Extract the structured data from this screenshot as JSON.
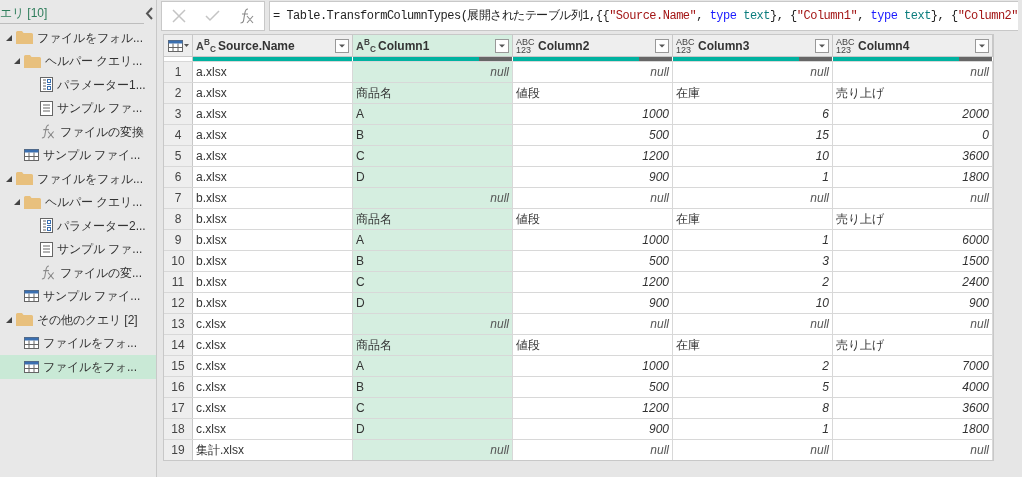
{
  "queries_pane": {
    "title": "エリ [10]",
    "tree": [
      {
        "label": "ファイルをフォル...",
        "kind": "folder",
        "expanded": true,
        "selected": false,
        "children": [
          {
            "label": "ヘルパー クエリ...",
            "kind": "folder",
            "expanded": true,
            "selected": false,
            "children": [
              {
                "label": "パラメーター1...",
                "kind": "parameter",
                "selected": false
              },
              {
                "label": "サンプル ファ...",
                "kind": "list",
                "selected": false
              },
              {
                "label": "ファイルの変換",
                "kind": "function",
                "selected": false
              }
            ]
          },
          {
            "label": "サンプル ファイ...",
            "kind": "table",
            "selected": false
          }
        ]
      },
      {
        "label": "ファイルをフォル...",
        "kind": "folder",
        "expanded": true,
        "selected": false,
        "children": [
          {
            "label": "ヘルパー クエリ...",
            "kind": "folder",
            "expanded": true,
            "selected": false,
            "children": [
              {
                "label": "パラメーター2...",
                "kind": "parameter",
                "selected": false
              },
              {
                "label": "サンプル ファ...",
                "kind": "list",
                "selected": false
              },
              {
                "label": "ファイルの変...",
                "kind": "function",
                "selected": false
              }
            ]
          },
          {
            "label": "サンプル ファイ...",
            "kind": "table",
            "selected": false
          }
        ]
      },
      {
        "label": "その他のクエリ [2]",
        "kind": "folder",
        "expanded": true,
        "selected": false,
        "children": [
          {
            "label": "ファイルをフォ...",
            "kind": "table",
            "selected": false
          },
          {
            "label": "ファイルをフォ...",
            "kind": "table",
            "selected": true
          }
        ]
      }
    ]
  },
  "formula_bar": {
    "tokens": [
      {
        "text": "= Table.TransformColumnTypes(展開されたテーブル列1,{{",
        "kind": "plain"
      },
      {
        "text": "\"Source.Name\"",
        "kind": "string"
      },
      {
        "text": ", ",
        "kind": "plain"
      },
      {
        "text": "type",
        "kind": "keyword"
      },
      {
        "text": " text",
        "kind": "type"
      },
      {
        "text": "}, {",
        "kind": "plain"
      },
      {
        "text": "\"Column1\"",
        "kind": "string"
      },
      {
        "text": ", ",
        "kind": "plain"
      },
      {
        "text": "type",
        "kind": "keyword"
      },
      {
        "text": " text",
        "kind": "type"
      },
      {
        "text": "}, {",
        "kind": "plain"
      },
      {
        "text": "\"Column2\"",
        "kind": "string"
      }
    ]
  },
  "table": {
    "columns": [
      {
        "name": "Source.Name",
        "type_label": [
          "A$^{B}$$_{C}$"
        ],
        "selected": false,
        "level": 1
      },
      {
        "name": "Column1",
        "type_label": [
          "A$^{B}$$_{C}$"
        ],
        "selected": true,
        "level": 0.79
      },
      {
        "name": "Column2",
        "type_label": [
          "ABC",
          "123"
        ],
        "selected": false,
        "level": 0.79
      },
      {
        "name": "Column3",
        "type_label": [
          "ABC",
          "123"
        ],
        "selected": false,
        "level": 0.79
      },
      {
        "name": "Column4",
        "type_label": [
          "ABC",
          "123"
        ],
        "selected": false,
        "level": 0.79
      }
    ],
    "rows": [
      {
        "index": "1",
        "cells": [
          {
            "text": "a.xlsx",
            "kind": "text"
          },
          {
            "text": "null",
            "kind": "null"
          },
          {
            "text": "null",
            "kind": "null"
          },
          {
            "text": "null",
            "kind": "null"
          },
          {
            "text": "null",
            "kind": "null"
          }
        ]
      },
      {
        "index": "2",
        "cells": [
          {
            "text": "a.xlsx",
            "kind": "text"
          },
          {
            "text": "商品名",
            "kind": "text"
          },
          {
            "text": "値段",
            "kind": "text"
          },
          {
            "text": "在庫",
            "kind": "text"
          },
          {
            "text": "売り上げ",
            "kind": "text"
          }
        ]
      },
      {
        "index": "3",
        "cells": [
          {
            "text": "a.xlsx",
            "kind": "text"
          },
          {
            "text": "A",
            "kind": "text"
          },
          {
            "text": "1000",
            "kind": "number"
          },
          {
            "text": "6",
            "kind": "number"
          },
          {
            "text": "2000",
            "kind": "number"
          }
        ]
      },
      {
        "index": "4",
        "cells": [
          {
            "text": "a.xlsx",
            "kind": "text"
          },
          {
            "text": "B",
            "kind": "text"
          },
          {
            "text": "500",
            "kind": "number"
          },
          {
            "text": "15",
            "kind": "number"
          },
          {
            "text": "0",
            "kind": "number"
          }
        ]
      },
      {
        "index": "5",
        "cells": [
          {
            "text": "a.xlsx",
            "kind": "text"
          },
          {
            "text": "C",
            "kind": "text"
          },
          {
            "text": "1200",
            "kind": "number"
          },
          {
            "text": "10",
            "kind": "number"
          },
          {
            "text": "3600",
            "kind": "number"
          }
        ]
      },
      {
        "index": "6",
        "cells": [
          {
            "text": "a.xlsx",
            "kind": "text"
          },
          {
            "text": "D",
            "kind": "text"
          },
          {
            "text": "900",
            "kind": "number"
          },
          {
            "text": "1",
            "kind": "number"
          },
          {
            "text": "1800",
            "kind": "number"
          }
        ]
      },
      {
        "index": "7",
        "cells": [
          {
            "text": "b.xlsx",
            "kind": "text"
          },
          {
            "text": "null",
            "kind": "null"
          },
          {
            "text": "null",
            "kind": "null"
          },
          {
            "text": "null",
            "kind": "null"
          },
          {
            "text": "null",
            "kind": "null"
          }
        ]
      },
      {
        "index": "8",
        "cells": [
          {
            "text": "b.xlsx",
            "kind": "text"
          },
          {
            "text": "商品名",
            "kind": "text"
          },
          {
            "text": "値段",
            "kind": "text"
          },
          {
            "text": "在庫",
            "kind": "text"
          },
          {
            "text": "売り上げ",
            "kind": "text"
          }
        ]
      },
      {
        "index": "9",
        "cells": [
          {
            "text": "b.xlsx",
            "kind": "text"
          },
          {
            "text": "A",
            "kind": "text"
          },
          {
            "text": "1000",
            "kind": "number"
          },
          {
            "text": "1",
            "kind": "number"
          },
          {
            "text": "6000",
            "kind": "number"
          }
        ]
      },
      {
        "index": "10",
        "cells": [
          {
            "text": "b.xlsx",
            "kind": "text"
          },
          {
            "text": "B",
            "kind": "text"
          },
          {
            "text": "500",
            "kind": "number"
          },
          {
            "text": "3",
            "kind": "number"
          },
          {
            "text": "1500",
            "kind": "number"
          }
        ]
      },
      {
        "index": "11",
        "cells": [
          {
            "text": "b.xlsx",
            "kind": "text"
          },
          {
            "text": "C",
            "kind": "text"
          },
          {
            "text": "1200",
            "kind": "number"
          },
          {
            "text": "2",
            "kind": "number"
          },
          {
            "text": "2400",
            "kind": "number"
          }
        ]
      },
      {
        "index": "12",
        "cells": [
          {
            "text": "b.xlsx",
            "kind": "text"
          },
          {
            "text": "D",
            "kind": "text"
          },
          {
            "text": "900",
            "kind": "number"
          },
          {
            "text": "10",
            "kind": "number"
          },
          {
            "text": "900",
            "kind": "number"
          }
        ]
      },
      {
        "index": "13",
        "cells": [
          {
            "text": "c.xlsx",
            "kind": "text"
          },
          {
            "text": "null",
            "kind": "null"
          },
          {
            "text": "null",
            "kind": "null"
          },
          {
            "text": "null",
            "kind": "null"
          },
          {
            "text": "null",
            "kind": "null"
          }
        ]
      },
      {
        "index": "14",
        "cells": [
          {
            "text": "c.xlsx",
            "kind": "text"
          },
          {
            "text": "商品名",
            "kind": "text"
          },
          {
            "text": "値段",
            "kind": "text"
          },
          {
            "text": "在庫",
            "kind": "text"
          },
          {
            "text": "売り上げ",
            "kind": "text"
          }
        ]
      },
      {
        "index": "15",
        "cells": [
          {
            "text": "c.xlsx",
            "kind": "text"
          },
          {
            "text": "A",
            "kind": "text"
          },
          {
            "text": "1000",
            "kind": "number"
          },
          {
            "text": "2",
            "kind": "number"
          },
          {
            "text": "7000",
            "kind": "number"
          }
        ]
      },
      {
        "index": "16",
        "cells": [
          {
            "text": "c.xlsx",
            "kind": "text"
          },
          {
            "text": "B",
            "kind": "text"
          },
          {
            "text": "500",
            "kind": "number"
          },
          {
            "text": "5",
            "kind": "number"
          },
          {
            "text": "4000",
            "kind": "number"
          }
        ]
      },
      {
        "index": "17",
        "cells": [
          {
            "text": "c.xlsx",
            "kind": "text"
          },
          {
            "text": "C",
            "kind": "text"
          },
          {
            "text": "1200",
            "kind": "number"
          },
          {
            "text": "8",
            "kind": "number"
          },
          {
            "text": "3600",
            "kind": "number"
          }
        ]
      },
      {
        "index": "18",
        "cells": [
          {
            "text": "c.xlsx",
            "kind": "text"
          },
          {
            "text": "D",
            "kind": "text"
          },
          {
            "text": "900",
            "kind": "number"
          },
          {
            "text": "1",
            "kind": "number"
          },
          {
            "text": "1800",
            "kind": "number"
          }
        ]
      },
      {
        "index": "19",
        "cells": [
          {
            "text": "集計.xlsx",
            "kind": "text"
          },
          {
            "text": "null",
            "kind": "null"
          },
          {
            "text": "null",
            "kind": "null"
          },
          {
            "text": "null",
            "kind": "null"
          },
          {
            "text": "null",
            "kind": "null"
          }
        ]
      }
    ]
  }
}
